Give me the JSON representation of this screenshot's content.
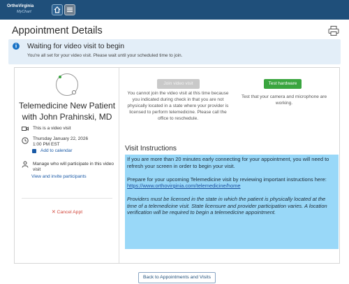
{
  "header": {
    "logo_brand": "OrthoVirginia",
    "logo_sub": "MyChart",
    "home_label": "Home",
    "menu_label": "Menu"
  },
  "page": {
    "title": "Appointment Details"
  },
  "banner": {
    "title": "Waiting for video visit to begin",
    "text": "You're all set for your video visit. Please wait until your scheduled time to join."
  },
  "visit": {
    "title": "Telemedicine New Patient with John Prahinski, MD",
    "type_text": "This is a video visit",
    "date": "Thursday January 22, 2026",
    "time": "1:00 PM EST",
    "add_calendar": "Add to calendar",
    "manage_text_line1": "Manage who will participate in this video",
    "manage_text_line2": "visit",
    "invite_link": "View and invite participants",
    "cancel": "Cancel Appt"
  },
  "join": {
    "button": "Join video visit",
    "text": "You cannot join the video visit at this time because you indicated during check in that you are not physically located in a state where your provider is licensed to perform telemedicine. Please call the office to reschedule."
  },
  "test": {
    "button": "Test hardware",
    "text": "Test that your camera and microphone are working."
  },
  "instructions": {
    "title": "Visit Instructions",
    "p1": "If you are more than 20 minutes early connecting for your appointment, you will need to refresh your screen in order to begin your visit.",
    "p2": "Prepare for your upcoming Telemedicine visit by reviewing important instructions here:",
    "link": "https://www.orthovirginia.com/telemedicine/home",
    "p3": "Providers must be licensed in the state in which the patient is physically located at the time of a telemedicine visit. State licensure and provider participation varies. A location verification will be required to begin a telemedicine appointment."
  },
  "footer": {
    "back": "Back to Appointments and Visits"
  },
  "colors": {
    "topbar": "#1f4f7a",
    "test_button": "#3aa53f",
    "instructions_bg": "#99d8f8",
    "cancel": "#d0453a",
    "link": "#1a5aa6"
  },
  "icons": [
    "home-icon",
    "menu-icon",
    "print-icon",
    "info-icon",
    "video-icon",
    "clock-icon",
    "calendar-icon",
    "participants-icon",
    "close-icon"
  ]
}
